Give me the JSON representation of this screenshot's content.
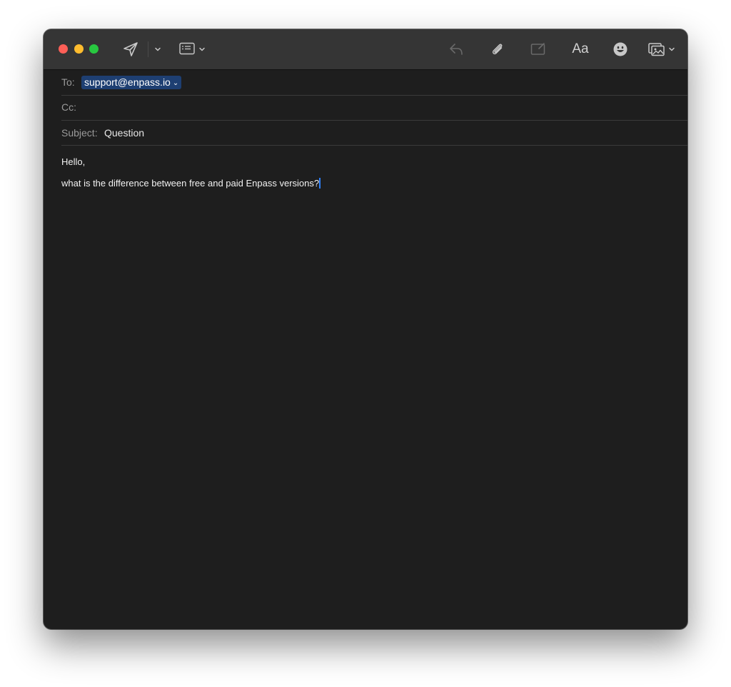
{
  "compose": {
    "to_label": "To:",
    "to_recipient": "support@enpass.io",
    "cc_label": "Cc:",
    "subject_label": "Subject:",
    "subject_value": "Question",
    "body_lines": [
      "Hello,",
      "what is the difference between free and paid Enpass versions?"
    ]
  },
  "toolbar": {
    "font_button_label": "Aa",
    "icons": [
      "send-icon",
      "chevron-down-icon",
      "header-fields-icon",
      "reply-icon",
      "paperclip-icon",
      "markup-icon",
      "emoji-icon",
      "photo-browser-icon"
    ]
  },
  "colors": {
    "window_bg": "#1e1e1e",
    "toolbar_bg": "#353535",
    "token_bg": "#1e3f72",
    "caret": "#2d7ff9",
    "close": "#fe5f57",
    "minimize": "#febc2e",
    "maximize": "#28c840"
  }
}
